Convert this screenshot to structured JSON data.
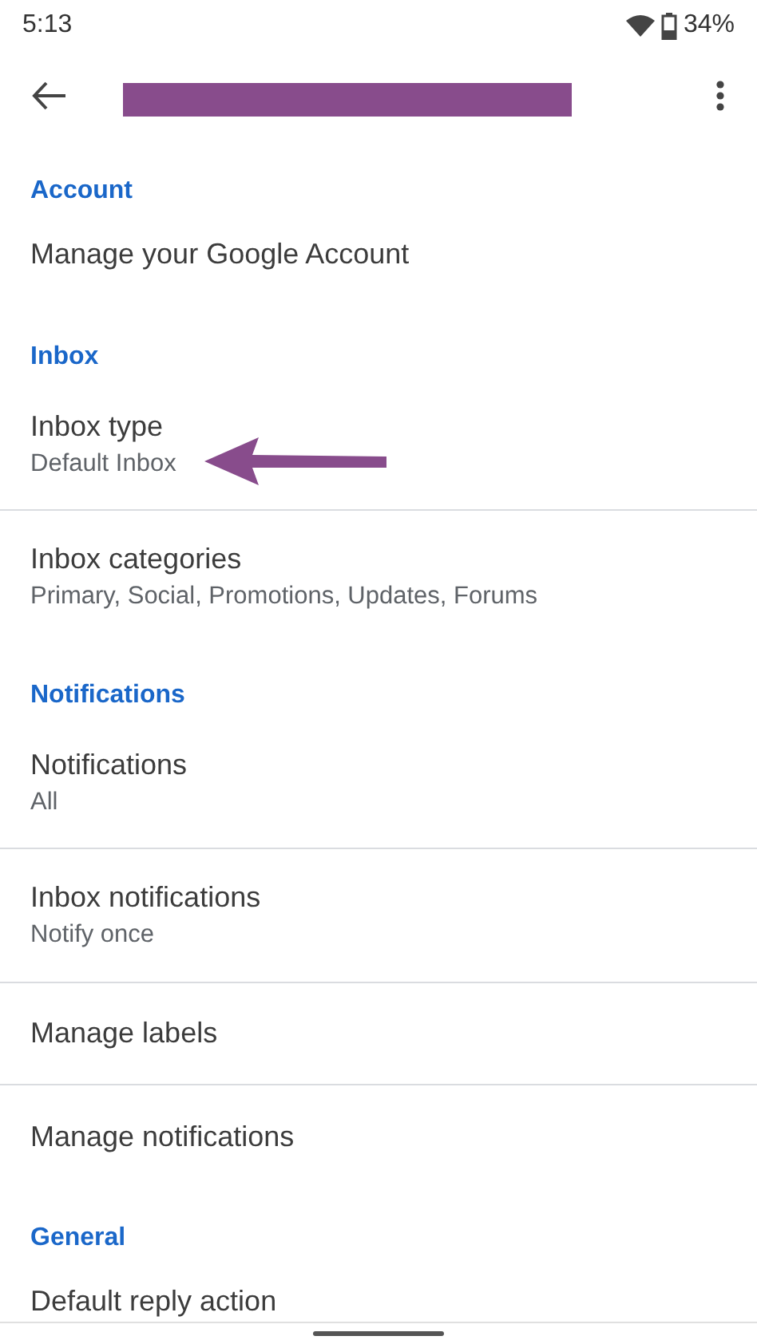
{
  "status_bar": {
    "time": "5:13",
    "battery": "34%"
  },
  "sections": [
    {
      "header": "Account",
      "items": [
        {
          "kind": "single",
          "title": "Manage your Google Account",
          "divider": false
        }
      ]
    },
    {
      "header": "Inbox",
      "items": [
        {
          "kind": "double",
          "title": "Inbox type",
          "subtitle": "Default Inbox",
          "divider": true
        },
        {
          "kind": "double",
          "title": "Inbox categories",
          "subtitle": "Primary, Social, Promotions, Updates, Forums",
          "divider": false
        }
      ]
    },
    {
      "header": "Notifications",
      "items": [
        {
          "kind": "double",
          "title": "Notifications",
          "subtitle": "All",
          "divider": true
        },
        {
          "kind": "double",
          "title": "Inbox notifications",
          "subtitle": "Notify once",
          "divider": true
        },
        {
          "kind": "single",
          "title": "Manage labels",
          "divider": true
        },
        {
          "kind": "single",
          "title": "Manage notifications",
          "divider": false
        }
      ]
    },
    {
      "header": "General",
      "items": [
        {
          "kind": "single",
          "title": "Default reply action"
        }
      ]
    }
  ]
}
